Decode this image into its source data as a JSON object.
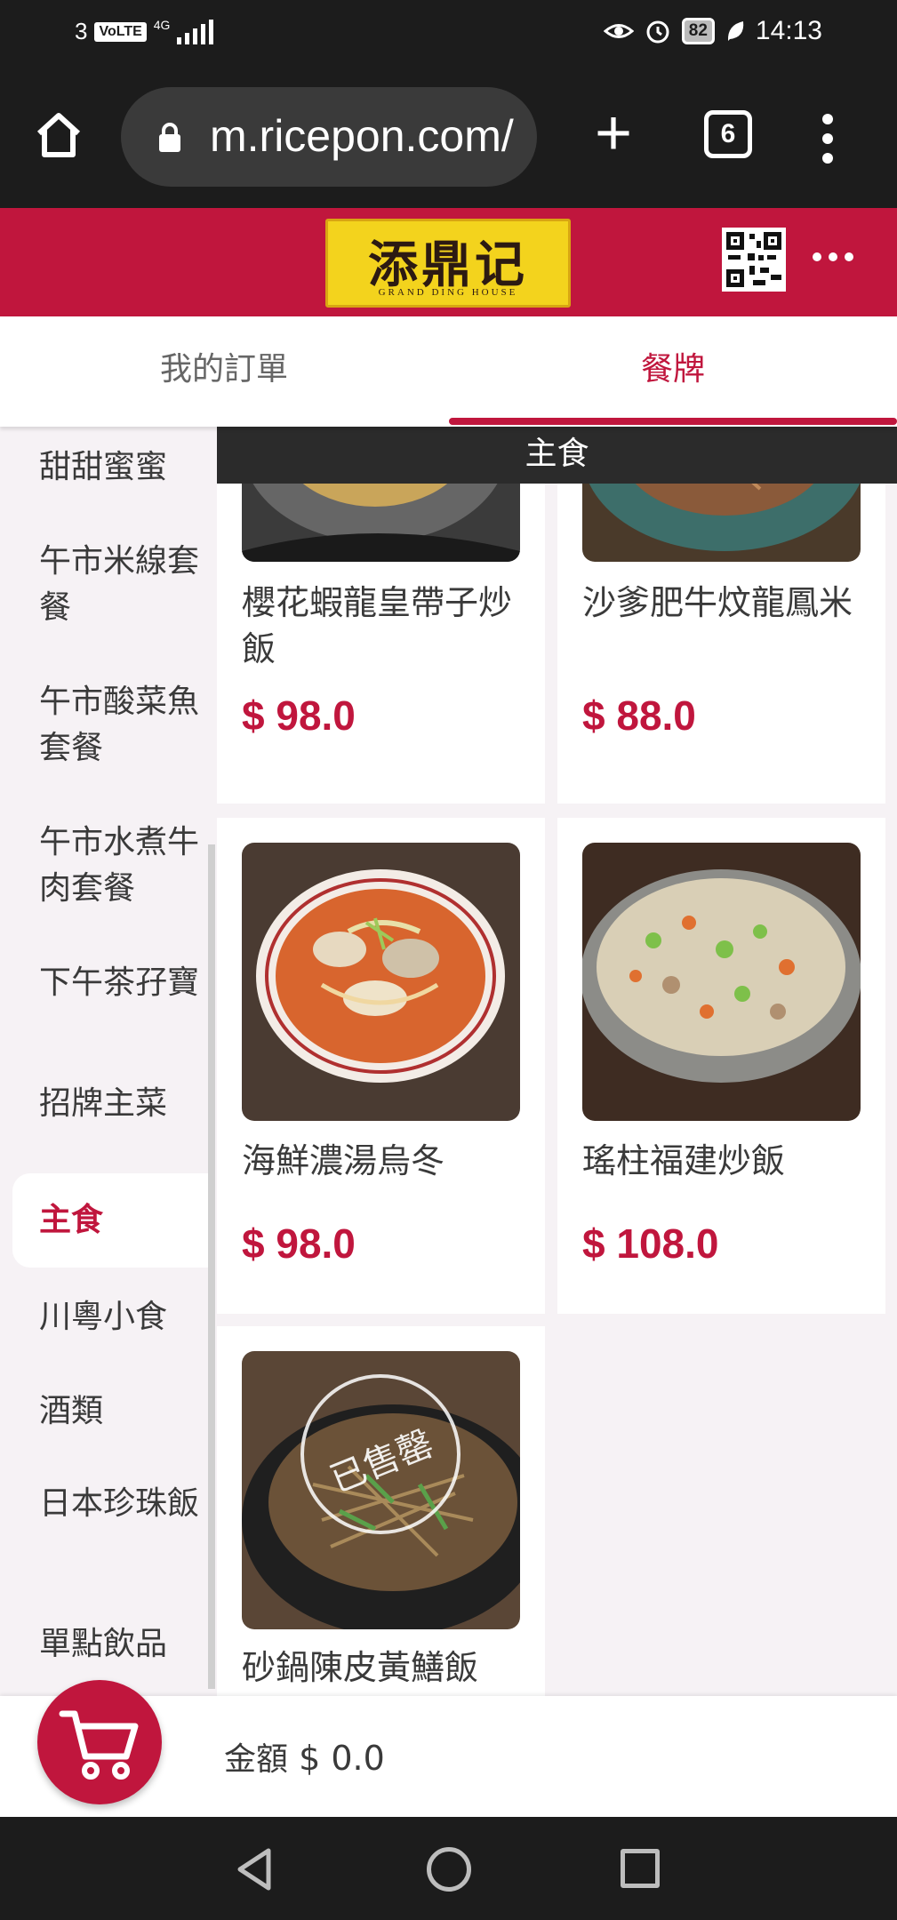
{
  "status_bar": {
    "sim": "3",
    "volte": "VoLTE",
    "network": "4G",
    "battery": "82",
    "time": "14:13"
  },
  "browser": {
    "url": "m.ricepon.com/",
    "tab_count": "6"
  },
  "header": {
    "logo_text": "添鼎记",
    "logo_subtext": "GRAND DING HOUSE"
  },
  "tabs": [
    {
      "label": "我的訂單",
      "active": false
    },
    {
      "label": "餐牌",
      "active": true
    }
  ],
  "sidebar": {
    "categories": [
      {
        "label": "甜甜蜜蜜",
        "active": false
      },
      {
        "label": "午市米線套餐",
        "active": false
      },
      {
        "label": "午市酸菜魚套餐",
        "active": false
      },
      {
        "label": "午市水煮牛肉套餐",
        "active": false
      },
      {
        "label": "下午茶孖寶",
        "active": false
      },
      {
        "label": "招牌主菜",
        "active": false
      },
      {
        "label": "主食",
        "active": true
      },
      {
        "label": "川粵小食",
        "active": false
      },
      {
        "label": "酒類",
        "active": false
      },
      {
        "label": "日本珍珠飯",
        "active": false
      },
      {
        "label": "單點飲品",
        "active": false
      }
    ]
  },
  "section": {
    "title": "主食"
  },
  "products": [
    {
      "name": "櫻花蝦龍皇帶子炒飯",
      "price": "$ 98.0",
      "sold_out": false
    },
    {
      "name": "沙爹肥牛炆龍鳳米",
      "price": "$ 88.0",
      "sold_out": false
    },
    {
      "name": "海鮮濃湯烏冬",
      "price": "$ 98.0",
      "sold_out": false
    },
    {
      "name": "瑤柱福建炒飯",
      "price": "$ 108.0",
      "sold_out": false
    },
    {
      "name": "砂鍋陳皮黃鱔飯",
      "price": "",
      "sold_out": true,
      "sold_out_label": "已售罄"
    }
  ],
  "cart": {
    "amount_label": "金額",
    "amount": "$ 0.0"
  },
  "colors": {
    "brand": "#c0163d",
    "dark": "#1c1c1c",
    "logo_yellow": "#f3d31d"
  }
}
